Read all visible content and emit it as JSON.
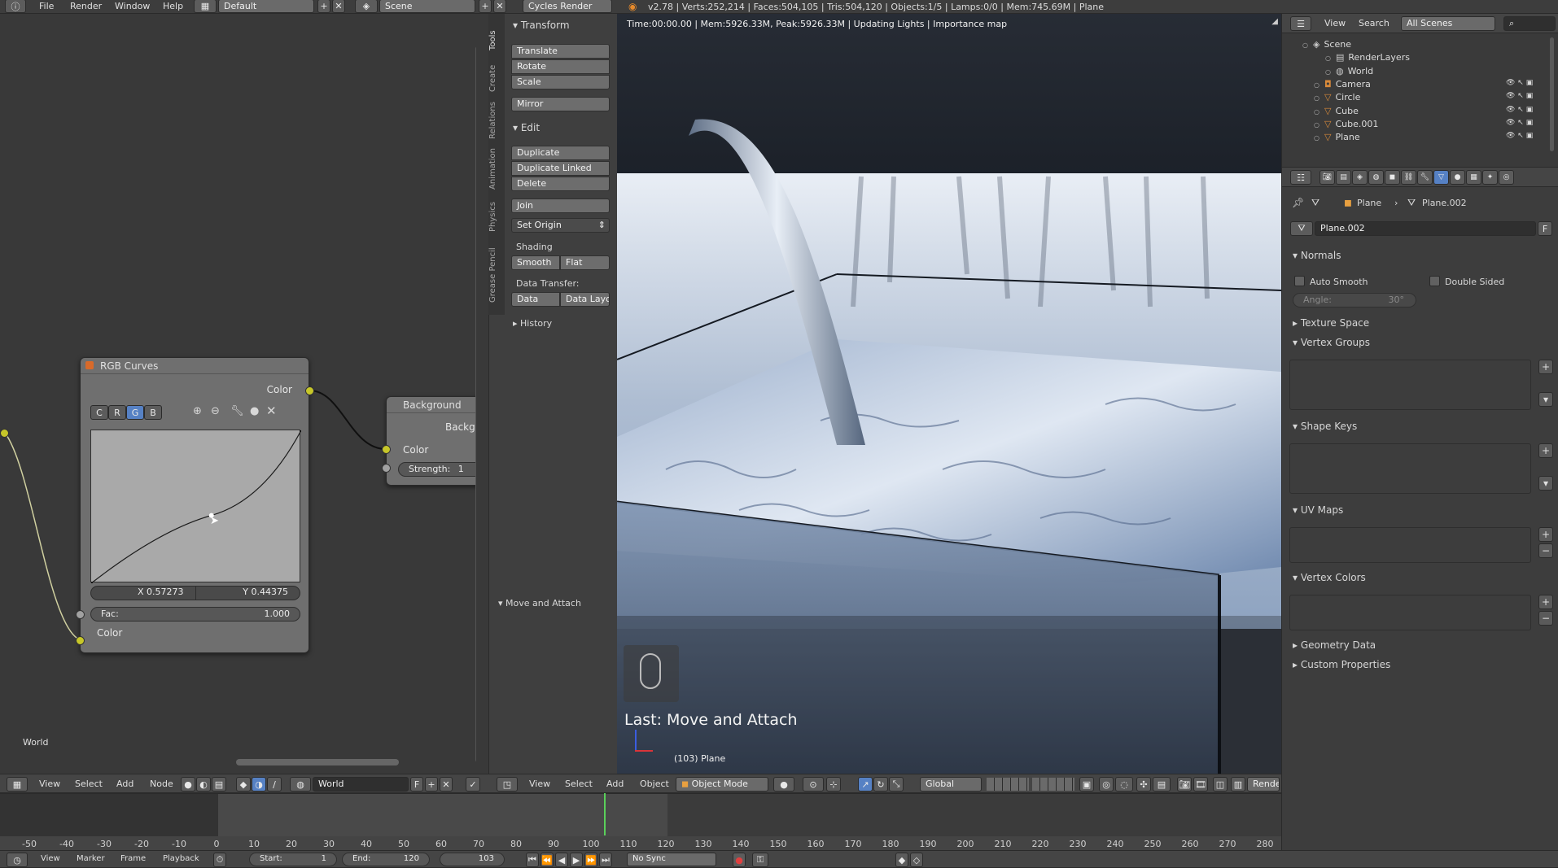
{
  "top_menu": {
    "items": [
      "File",
      "Render",
      "Window",
      "Help"
    ],
    "layout": "Default",
    "scene": "Scene",
    "engine": "Cycles Render",
    "stats": "v2.78 | Verts:252,214 | Faces:504,105 | Tris:504,120 | Objects:1/5 | Lamps:0/0 | Mem:745.69M | Plane"
  },
  "node_editor": {
    "rgb_node": {
      "title": "RGB Curves",
      "output_label": "Color",
      "channels": [
        "C",
        "R",
        "G",
        "B"
      ],
      "active_channel": "G",
      "x_field": "X 0.57273",
      "y_field": "Y 0.44375",
      "fac_label": "Fac:",
      "fac_value": "1.000",
      "input_label": "Color",
      "curve_points": [
        [
          0,
          0
        ],
        [
          0.57273,
          0.44375
        ],
        [
          1,
          1
        ]
      ]
    },
    "bg_node": {
      "title": "Background",
      "sub": "Backg",
      "color_label": "Color",
      "strength_label": "Strength:",
      "strength_value": "1"
    },
    "world_label": "World",
    "footer": {
      "menus": [
        "View",
        "Select",
        "Add",
        "Node"
      ],
      "world_field": "World",
      "f_label": "F"
    }
  },
  "tool_shelf": {
    "vertical_tabs": [
      "Tools",
      "Create",
      "Relations",
      "Animation",
      "Physics",
      "Grease Pencil"
    ],
    "transform_header": "Transform",
    "transform_buttons": [
      "Translate",
      "Rotate",
      "Scale"
    ],
    "mirror": "Mirror",
    "edit_header": "Edit",
    "edit_buttons": [
      "Duplicate",
      "Duplicate Linked",
      "Delete"
    ],
    "join": "Join",
    "set_origin": "Set Origin",
    "shading_label": "Shading",
    "shading_buttons": [
      "Smooth",
      "Flat"
    ],
    "data_transfer_label": "Data Transfer:",
    "data_buttons": [
      "Data",
      "Data Layo"
    ],
    "history": "History",
    "operator_panel": "Move and Attach"
  },
  "viewport": {
    "status": "Time:00:00.00 | Mem:5926.33M, Peak:5926.33M | Updating Lights | Importance map",
    "last_op": "Last: Move and Attach",
    "object_label": "(103) Plane",
    "footer": {
      "menus": [
        "View",
        "Select",
        "Add",
        "Object"
      ],
      "mode": "Object Mode",
      "orientation": "Global",
      "render_label": "Rende"
    }
  },
  "outliner": {
    "menus": [
      "View",
      "Search"
    ],
    "scenes_dropdown": "All Scenes",
    "rows": [
      {
        "label": "Scene",
        "icon": "scene-icon",
        "color": "#c9c9c9"
      },
      {
        "label": "RenderLayers",
        "icon": "renderlayers-icon",
        "color": "#c9c9c9"
      },
      {
        "label": "World",
        "icon": "world-icon",
        "color": "#c9c9c9"
      },
      {
        "label": "Camera",
        "icon": "camera-icon",
        "color": "#d88a3a"
      },
      {
        "label": "Circle",
        "icon": "mesh-icon",
        "color": "#d88a3a"
      },
      {
        "label": "Cube",
        "icon": "mesh-icon",
        "color": "#d88a3a"
      },
      {
        "label": "Cube.001",
        "icon": "mesh-icon",
        "color": "#d88a3a"
      },
      {
        "label": "Plane",
        "icon": "mesh-icon",
        "color": "#d88a3a"
      }
    ]
  },
  "properties": {
    "breadcrumb": [
      "Plane",
      "Plane.002"
    ],
    "data_name": "Plane.002",
    "f_label": "F",
    "normals_header": "Normals",
    "auto_smooth": "Auto Smooth",
    "double_sided": "Double Sided",
    "angle_label": "Angle:",
    "angle_value": "30°",
    "texture_space": "Texture Space",
    "vertex_groups": "Vertex Groups",
    "shape_keys": "Shape Keys",
    "uv_maps": "UV Maps",
    "vertex_colors": "Vertex Colors",
    "geometry_data": "Geometry Data",
    "custom_properties": "Custom Properties"
  },
  "timeline": {
    "ticks": [
      "-50",
      "-40",
      "-30",
      "-20",
      "-10",
      "0",
      "10",
      "20",
      "30",
      "40",
      "50",
      "60",
      "70",
      "80",
      "90",
      "100",
      "110",
      "120",
      "130",
      "140",
      "150",
      "160",
      "170",
      "180",
      "190",
      "200",
      "210",
      "220",
      "230",
      "240",
      "250",
      "260",
      "270",
      "280"
    ],
    "current_frame": 103,
    "footer_menus": [
      "View",
      "Marker",
      "Frame",
      "Playback"
    ],
    "start_label": "Start:",
    "start_value": "1",
    "end_label": "End:",
    "end_value": "120",
    "frame_value": "103",
    "sync": "No Sync"
  }
}
